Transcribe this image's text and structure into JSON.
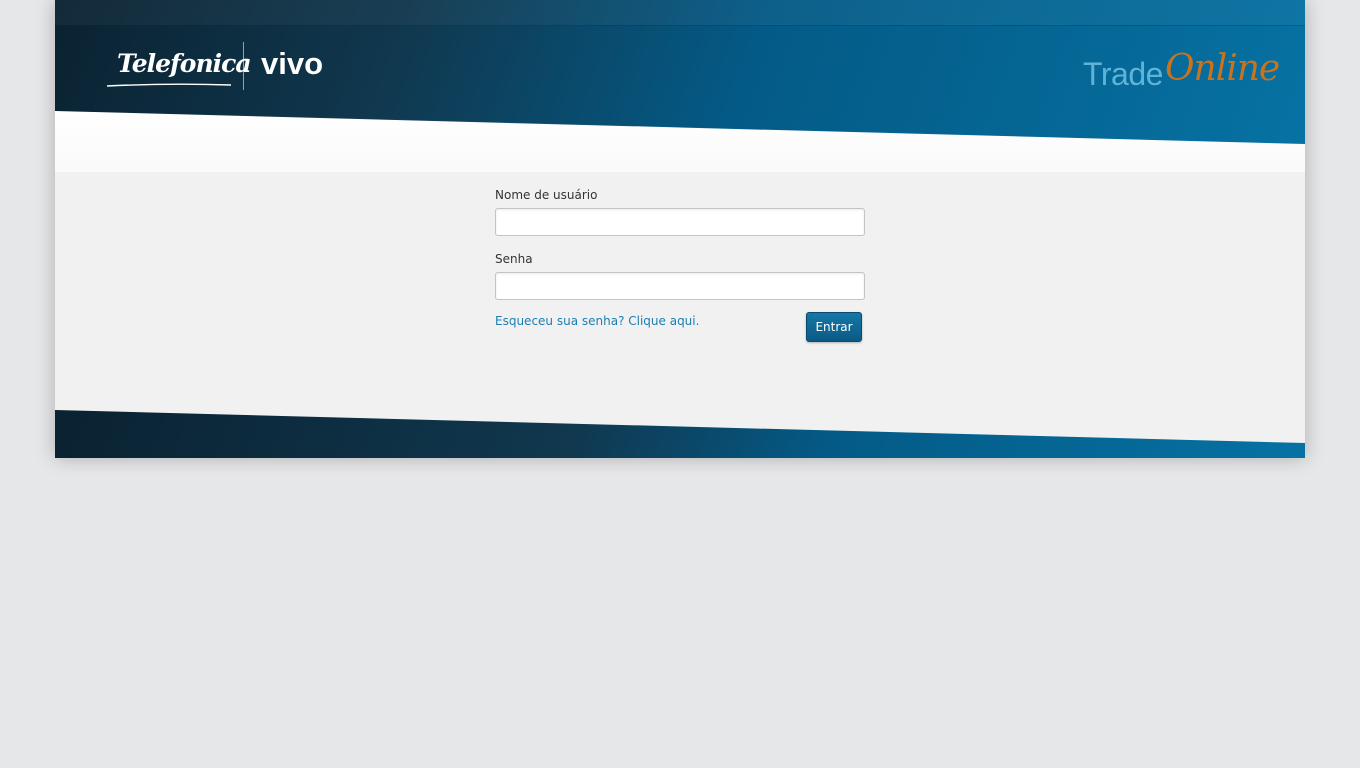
{
  "header": {
    "logos": {
      "telefonica": "Telefonica",
      "vivo": "vivo"
    },
    "brand": {
      "trade": "Trade",
      "online": "Online"
    }
  },
  "login_form": {
    "username_label": "Nome de usuário",
    "username_value": "",
    "password_label": "Senha",
    "password_value": "",
    "forgot_link": "Esqueceu sua senha? Clique aqui.",
    "submit_label": "Entrar"
  },
  "colors": {
    "brand_dark": "#0a2231",
    "brand_blue": "#0672a3",
    "link_blue": "#1a7eb5",
    "accent_orange": "#c8731f",
    "page_bg": "#e6e7e9",
    "content_bg": "#f1f1f1"
  }
}
